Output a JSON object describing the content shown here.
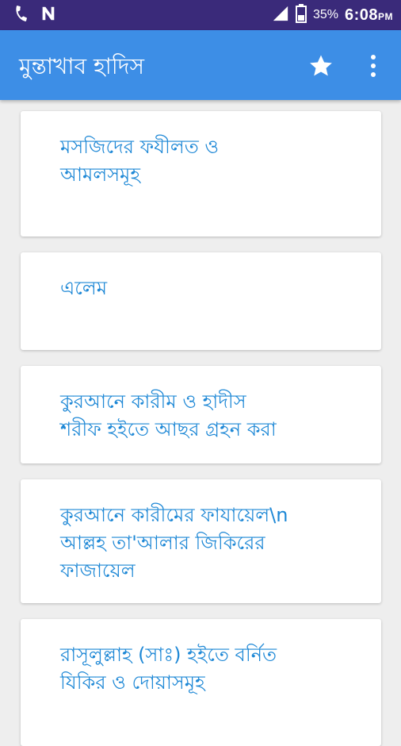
{
  "status_bar": {
    "icons": [
      "phone-icon",
      "n-notification-icon",
      "signal-icon",
      "battery-icon"
    ],
    "battery_percent": "35%",
    "time": "6:08",
    "ampm": "PM"
  },
  "app_bar": {
    "title": "মুন্তাখাব হাদিস",
    "actions": [
      "star-icon",
      "more-vertical-icon"
    ],
    "color": "#3d8ee6"
  },
  "items": [
    {
      "label": "মসজিদের ফযীলত ও\nআমলসমূহ"
    },
    {
      "label": "এলেম"
    },
    {
      "label": "কুরআনে কারীম ও হাদীস\nশরীফ হইতে আছর গ্রহন করা"
    },
    {
      "label": "কুরআনে কারীমের ফাযায়েল\\n\nআল্লহ তা'আলার জিকিরের\nফাজায়েল"
    },
    {
      "label": "রাসূলুল্লাহ (সাঃ) হইতে বর্নিত\nযিকির ও দোয়াসমূহ"
    }
  ],
  "colors": {
    "status_bar": "#3a2a7a",
    "item_text": "#1e88d6",
    "background": "#eeeeee"
  }
}
